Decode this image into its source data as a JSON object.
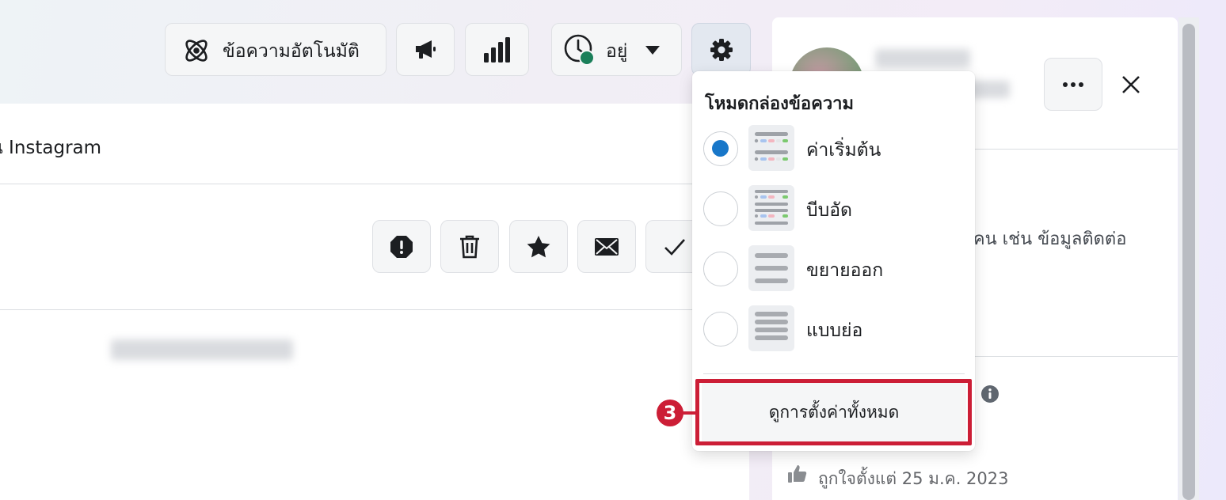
{
  "toolbar": {
    "auto_message_label": "ข้อความอัตโนมัติ",
    "status_label": "อยู่",
    "icons": [
      "atom-icon",
      "megaphone-icon",
      "bar-chart-icon",
      "clock-icon",
      "caret-down-icon",
      "gear-icon"
    ]
  },
  "main": {
    "instagram_text": "น Instagram",
    "action_icons": [
      "alert-icon",
      "trash-icon",
      "star-icon",
      "envelope-icon",
      "check-icon"
    ]
  },
  "right_panel": {
    "info_text": "ผู้คน เช่น ข้อมูลติดต่อ",
    "likes_text": "ถูกใจตั้งแต่ 25 ม.ค. 2023"
  },
  "dropdown": {
    "title": "โหมดกล่องข้อความ",
    "options": [
      {
        "label": "ค่าเริ่มต้น",
        "selected": true
      },
      {
        "label": "บีบอัด",
        "selected": false
      },
      {
        "label": "ขยายออก",
        "selected": false
      },
      {
        "label": "แบบย่อ",
        "selected": false
      }
    ],
    "view_all_label": "ดูการตั้งค่าทั้งหมด"
  },
  "annotation": {
    "step_number": "3",
    "color": "#cc1e36"
  },
  "colors": {
    "accent": "#1877c9",
    "online": "#1a7f5a"
  }
}
